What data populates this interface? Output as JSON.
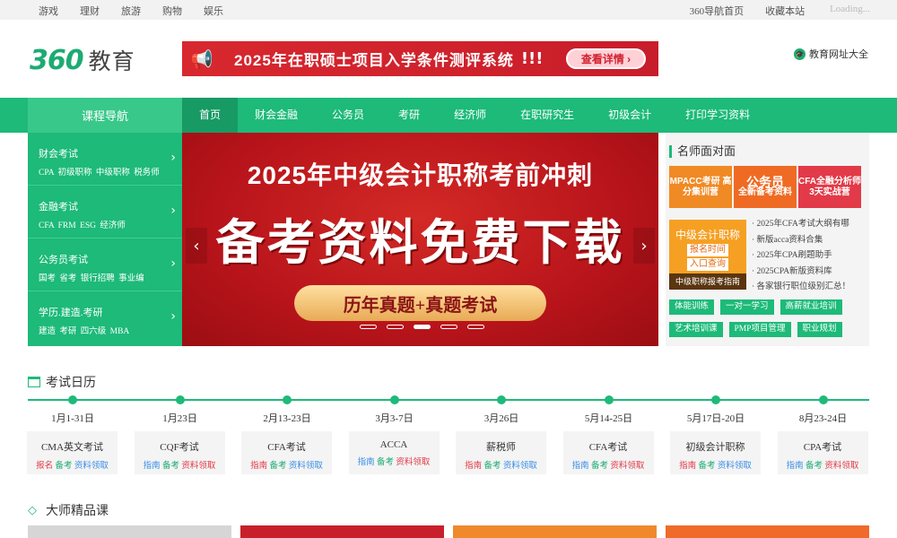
{
  "topbar": {
    "left": [
      "游戏",
      "理财",
      "旅游",
      "购物",
      "娱乐"
    ],
    "right": [
      "360导航首页",
      "收藏本站"
    ],
    "loading": "Loading..."
  },
  "header": {
    "logo_num": "360",
    "logo_text": "教育",
    "banner_text": "2025年在职硕士项目入学条件测评系统",
    "banner_exclaim": "!!!",
    "banner_btn": "查看详情 ›",
    "edu_all": "教育网址大全"
  },
  "nav": {
    "course_nav": "课程导航",
    "items": [
      "首页",
      "财会金融",
      "公务员",
      "考研",
      "经济师",
      "在职研究生",
      "初级会计",
      "打印学习资料"
    ]
  },
  "side": [
    {
      "title": "财会考试",
      "sub": "CPA  初级职称  中级职称  税务师"
    },
    {
      "title": "金融考试",
      "sub": "CFA  FRM  ESG  经济师"
    },
    {
      "title": "公务员考试",
      "sub": "国考  省考  银行招聘  事业编"
    },
    {
      "title": "学历.建造.考研",
      "sub": "建造  考研  四六级  MBA"
    }
  ],
  "slider": {
    "line1": "2025年中级会计职称考前冲刺",
    "line2": "备考资料免费下载",
    "line3": "历年真题+真题考试"
  },
  "right": {
    "heading": "名师面对面",
    "ad1": "MPACC考研 高分集训营",
    "ad2_big": "公务员",
    "ad2_small": "全新备考资料",
    "ad3": "CFA全融分析师 3天实战营",
    "pic_title": "中级会计职称",
    "pic_sub1": "报名时间",
    "pic_sub2": "入口查询",
    "pic_foot": "中级职称报考指南",
    "list": [
      "2025年CFA考试大纲有哪",
      "新版acca资料合集",
      "2025年CPA刷题助手",
      "2025CPA新版资料库",
      "各家银行职位级别汇总！"
    ],
    "tags": [
      "体能训练",
      "一对一学习",
      "高薪就业培训",
      "艺术培训课",
      "PMP项目管理",
      "职业规划"
    ]
  },
  "calendar": {
    "title": "考试日历",
    "events": [
      {
        "date": "1月1-31日",
        "name": "CMA英文考试",
        "links": [
          "报名",
          "备考",
          "资料领取"
        ]
      },
      {
        "date": "1月23日",
        "name": "CQF考试",
        "links": [
          "指南",
          "备考",
          "资料领取"
        ]
      },
      {
        "date": "2月13-23日",
        "name": "CFA考试",
        "links": [
          "指南",
          "备考",
          "资料领取"
        ]
      },
      {
        "date": "3月3-7日",
        "name": "ACCA",
        "links": [
          "指南",
          "备考",
          "资料领取"
        ]
      },
      {
        "date": "3月26日",
        "name": "薪税师",
        "links": [
          "指南",
          "备考",
          "资料领取"
        ]
      },
      {
        "date": "5月14-25日",
        "name": "CFA考试",
        "links": [
          "指南",
          "备考",
          "资料领取"
        ]
      },
      {
        "date": "5月17日-20日",
        "name": "初级会计职称",
        "links": [
          "指南",
          "备考",
          "资料领取"
        ]
      },
      {
        "date": "8月23-24日",
        "name": "CPA考试",
        "links": [
          "指南",
          "备考",
          "资料领取"
        ]
      }
    ]
  },
  "master": {
    "title": "大师精品课"
  },
  "colors": {
    "accent": "#1dba79",
    "red": "#d8282f"
  }
}
